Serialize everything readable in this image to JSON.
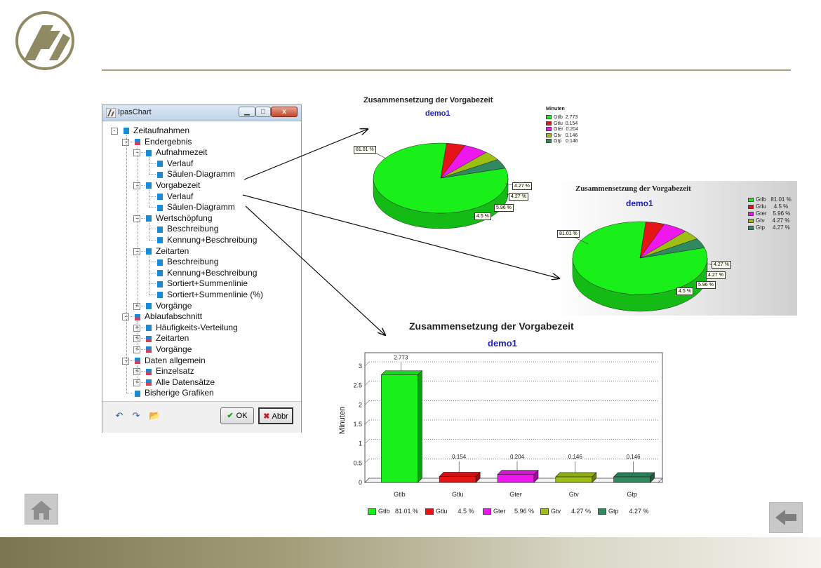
{
  "dialog": {
    "title": "IpasChart",
    "min_symbol": "▁",
    "max_symbol": "□",
    "close_symbol": "x",
    "tree": [
      {
        "label": "Zeitaufnahmen",
        "level": 0,
        "expander": "-",
        "icon": "blue"
      },
      {
        "label": "Endergebnis",
        "level": 1,
        "expander": "-",
        "icon": "mix"
      },
      {
        "label": "Aufnahmezeit",
        "level": 2,
        "expander": "-",
        "icon": "blue"
      },
      {
        "label": "Verlauf",
        "level": 3,
        "expander": "",
        "icon": "blue"
      },
      {
        "label": "Säulen-Diagramm",
        "level": 3,
        "expander": "",
        "icon": "blue"
      },
      {
        "label": "Vorgabezeit",
        "level": 2,
        "expander": "-",
        "icon": "blue"
      },
      {
        "label": "Verlauf",
        "level": 3,
        "expander": "",
        "icon": "blue"
      },
      {
        "label": "Säulen-Diagramm",
        "level": 3,
        "expander": "",
        "icon": "blue"
      },
      {
        "label": "Wertschöpfung",
        "level": 2,
        "expander": "-",
        "icon": "blue"
      },
      {
        "label": "Beschreibung",
        "level": 3,
        "expander": "",
        "icon": "blue"
      },
      {
        "label": "Kennung+Beschreibung",
        "level": 3,
        "expander": "",
        "icon": "blue"
      },
      {
        "label": "Zeitarten",
        "level": 2,
        "expander": "-",
        "icon": "blue"
      },
      {
        "label": "Beschreibung",
        "level": 3,
        "expander": "",
        "icon": "blue"
      },
      {
        "label": "Kennung+Beschreibung",
        "level": 3,
        "expander": "",
        "icon": "blue"
      },
      {
        "label": "Sortiert+Summenlinie",
        "level": 3,
        "expander": "",
        "icon": "blue"
      },
      {
        "label": "Sortiert+Summenlinie (%)",
        "level": 3,
        "expander": "",
        "icon": "blue"
      },
      {
        "label": "Vorgänge",
        "level": 2,
        "expander": "+",
        "icon": "blue"
      },
      {
        "label": "Ablaufabschnitt",
        "level": 1,
        "expander": "-",
        "icon": "mix"
      },
      {
        "label": "Häufigkeits-Verteilung",
        "level": 2,
        "expander": "+",
        "icon": "blue"
      },
      {
        "label": "Zeitarten",
        "level": 2,
        "expander": "+",
        "icon": "mix"
      },
      {
        "label": "Vorgänge",
        "level": 2,
        "expander": "+",
        "icon": "mix"
      },
      {
        "label": "Daten allgemein",
        "level": 1,
        "expander": "-",
        "icon": "mix"
      },
      {
        "label": "Einzelsatz",
        "level": 2,
        "expander": "+",
        "icon": "mix"
      },
      {
        "label": "Alle Datensätze",
        "level": 2,
        "expander": "+",
        "icon": "mix"
      },
      {
        "label": "Bisherige Grafiken",
        "level": 1,
        "expander": "",
        "icon": "blue"
      }
    ],
    "ok_label": "OK",
    "cancel_label": "Abbr",
    "undo_symbol": "↶",
    "redo_symbol": "↷",
    "open_symbol": "📂"
  },
  "colors": {
    "Gtlb": "#19f019",
    "Gtlu": "#e51515",
    "Gter": "#ee18ee",
    "Gtv": "#9cbf12",
    "Gtp": "#2f8a60"
  },
  "chart_data": [
    {
      "type": "pie",
      "title": "Zusammensetzung der Vorgabezeit",
      "subtitle": "demo1",
      "legend_title": "Minuten",
      "categories": [
        "Gtlb",
        "Gtlu",
        "Gter",
        "Gtv",
        "Gtp"
      ],
      "values": [
        2.773,
        0.154,
        0.204,
        0.146,
        0.146
      ],
      "legend_labels": [
        "Gtlb  2.773",
        "Gtlu  0.154",
        "Gter  0.204",
        "Gtv   0.146",
        "Gtp   0.146"
      ],
      "slice_labels": [
        "81.01 %",
        "4.5 %",
        "5.96 %",
        "4.27 %",
        "4.27 %"
      ],
      "legend_position": "top-right"
    },
    {
      "type": "pie",
      "title": "Zusammensetzung der Vorgabezeit",
      "subtitle": "demo1",
      "categories": [
        "Gtlb",
        "Gtlu",
        "Gter",
        "Gtv",
        "Gtp"
      ],
      "values": [
        81.01,
        4.5,
        5.96,
        4.27,
        4.27
      ],
      "legend_labels": [
        "Gtlb   81.01 %",
        "Gtlu     4.5 %",
        "Gter    5.96 %",
        "Gtv     4.27 %",
        "Gtp     4.27 %"
      ],
      "slice_labels": [
        "81.01 %",
        "4.5 %",
        "5.96 %",
        "4.27 %",
        "4.27 %"
      ],
      "legend_position": "top-right"
    },
    {
      "type": "bar",
      "title": "Zusammensetzung der Vorgabezeit",
      "subtitle": "demo1",
      "ylabel": "Minuten",
      "categories": [
        "Gtlb",
        "Gtlu",
        "Gter",
        "Gtv",
        "Gtp"
      ],
      "values": [
        2.773,
        0.154,
        0.204,
        0.146,
        0.146
      ],
      "value_labels": [
        "2.773",
        "0.154",
        "0.204",
        "0.146",
        "0.146"
      ],
      "yticks": [
        "0",
        "0.5",
        "1",
        "1.5",
        "2",
        "2.5",
        "3"
      ],
      "ylim": [
        0,
        3.2
      ],
      "grid": true,
      "legend_labels": [
        "Gtlb   81.01 %",
        "Gtlu      4.5 %",
        "Gter     5.96 %",
        "Gtv      4.27 %",
        "Gtp      4.27 %"
      ],
      "legend_position": "bottom"
    }
  ]
}
